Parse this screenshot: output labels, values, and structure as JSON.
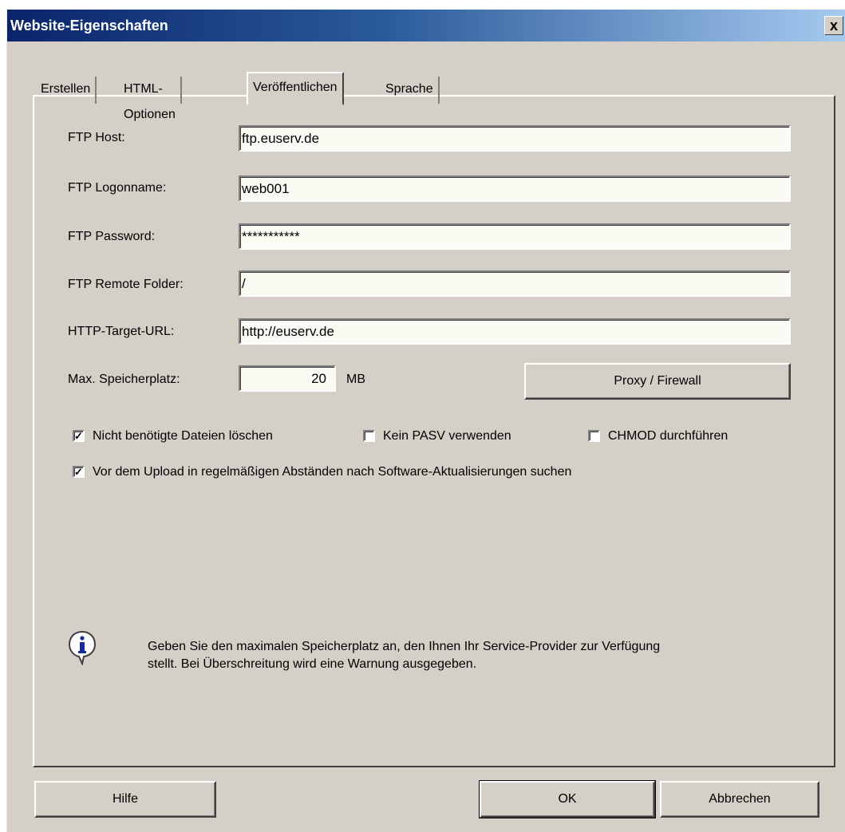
{
  "window": {
    "title": "Website-Eigenschaften",
    "close_label": "x"
  },
  "tabs": [
    {
      "label": "Erstellen"
    },
    {
      "label": "HTML-Optionen"
    },
    {
      "label": "Veröffentlichen"
    },
    {
      "label": "Sprache"
    }
  ],
  "active_tab": "Veröffentlichen",
  "fields": {
    "ftp_host": {
      "label": "FTP Host:",
      "value": "ftp.euserv.de"
    },
    "ftp_logon": {
      "label": "FTP Logonname:",
      "value": "web001"
    },
    "ftp_password": {
      "label": "FTP Password:",
      "value": "***********"
    },
    "ftp_folder": {
      "label": "FTP Remote Folder:",
      "value": "/"
    },
    "http_url": {
      "label": "HTTP-Target-URL:",
      "value": "http://euserv.de"
    },
    "max_storage": {
      "label": "Max. Speicherplatz:",
      "value": "20",
      "unit": "MB"
    }
  },
  "proxy_button": "Proxy / Firewall",
  "checkboxes": [
    {
      "label": "Nicht benötigte Dateien löschen",
      "checked": true
    },
    {
      "label": "Kein PASV verwenden",
      "checked": false
    },
    {
      "label": "CHMOD durchführen",
      "checked": false
    },
    {
      "label": "Vor dem Upload in regelmäßigen Abständen nach Software-Aktualisierungen suchen",
      "checked": true
    }
  ],
  "check_glyph": "✓",
  "info": {
    "icon": "info-icon",
    "line1": "Geben Sie den maximalen Speicherplatz an, den Ihnen Ihr Service-Provider zur Verfügung",
    "line2": "stellt. Bei Überschreitung wird eine Warnung ausgegeben."
  },
  "buttons": {
    "help": "Hilfe",
    "ok": "OK",
    "cancel": "Abbrechen"
  },
  "colors": {
    "dialog_bg": "#d4d0c8",
    "titlebar_start": "#0a246a",
    "titlebar_end": "#a6caf0",
    "field_bg": "#fafcf3"
  }
}
